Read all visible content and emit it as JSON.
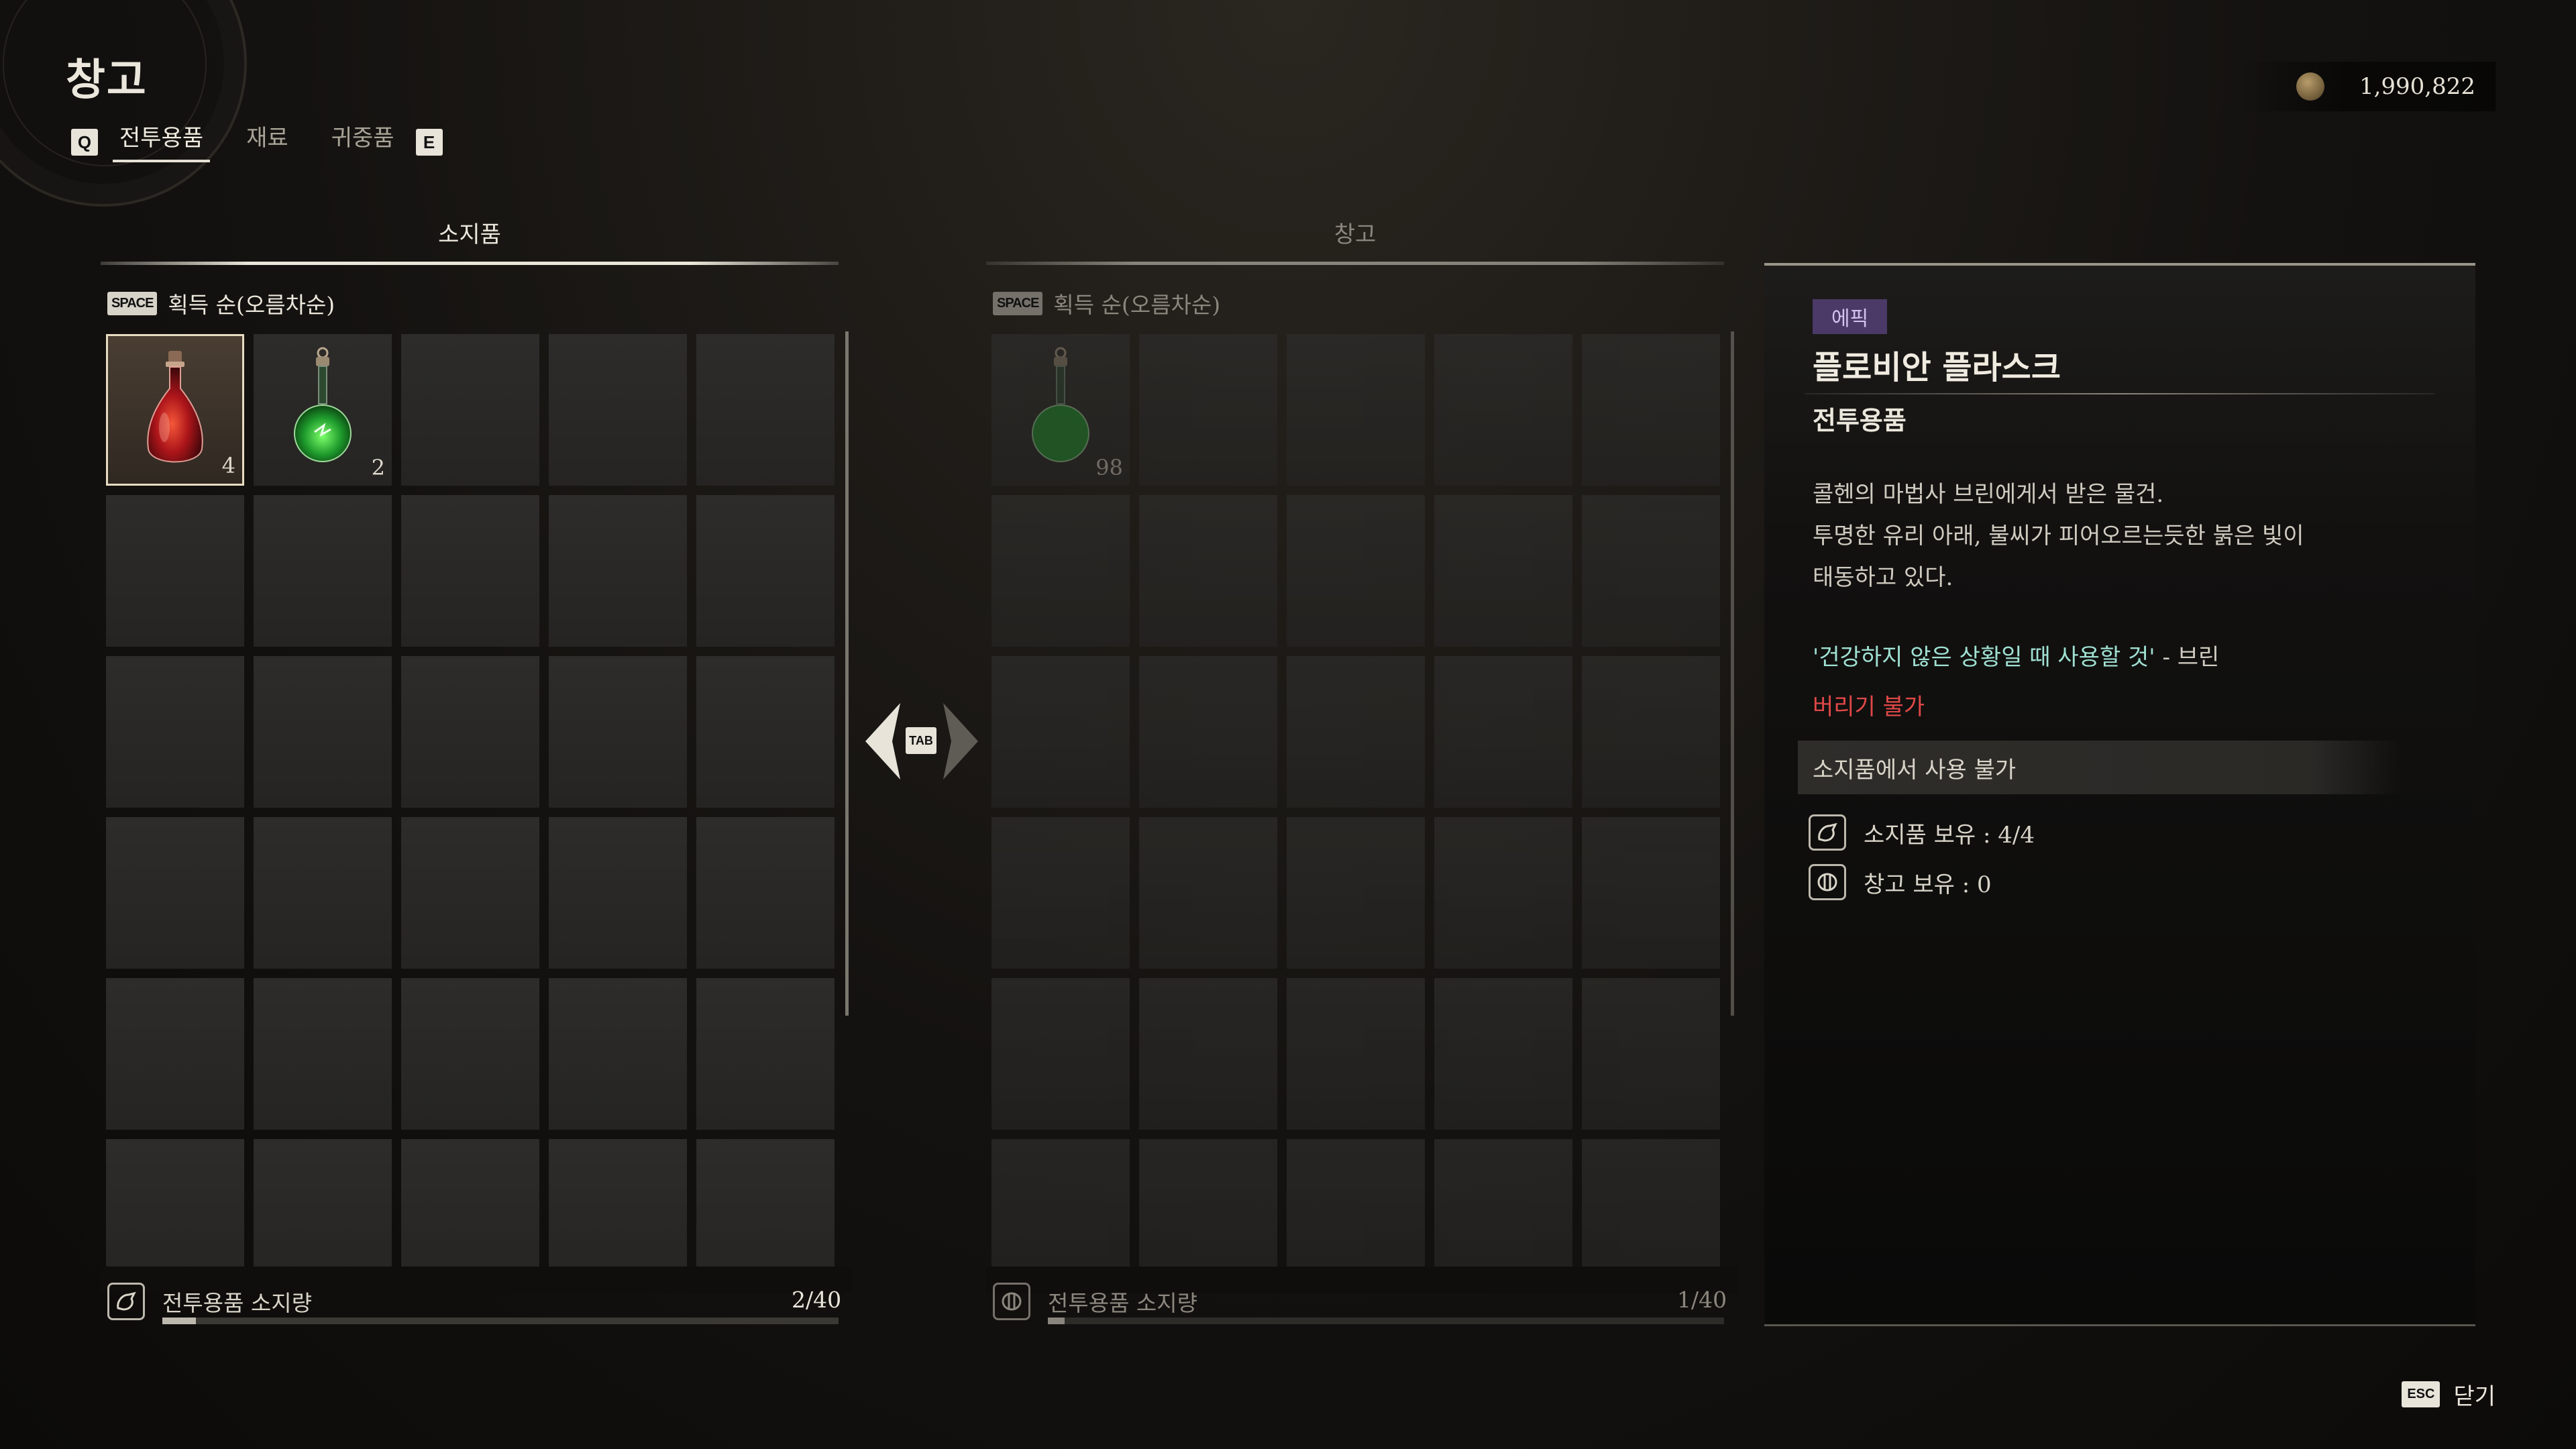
{
  "header": {
    "title": "창고",
    "prev_key": "Q",
    "next_key": "E",
    "tabs": [
      {
        "label": "전투용품",
        "active": true
      },
      {
        "label": "재료",
        "active": false
      },
      {
        "label": "귀중품",
        "active": false
      }
    ]
  },
  "currency": {
    "icon": "coin-icon",
    "value": "1,990,822"
  },
  "inventory": {
    "heading": "소지품",
    "sort_key": "SPACE",
    "sort_label": "획득 순(오름차순)",
    "slots": [
      {
        "item": "red-potion",
        "qty": "4",
        "selected": true
      },
      {
        "item": "green-flask",
        "qty": "2",
        "selected": false
      }
    ],
    "footer_label": "전투용품 소지량",
    "footer_count": "2/40",
    "fill": 0.05
  },
  "swap": {
    "key": "TAB"
  },
  "storage": {
    "heading": "창고",
    "sort_key": "SPACE",
    "sort_label": "획득 순(오름차순)",
    "slots": [
      {
        "item": "green-flask",
        "qty": "98",
        "selected": false
      }
    ],
    "footer_label": "전투용품 소지량",
    "footer_count": "1/40",
    "fill": 0.025
  },
  "detail": {
    "rarity": "에픽",
    "rarity_color": "#4b3a67",
    "name": "플로비안 플라스크",
    "category": "전투용품",
    "description": "콜헨의 마법사 브린에게서 받은 물건.\n투명한 유리 아래, 불씨가 피어오르는듯한 붉은 빛이\n태동하고 있다.",
    "quote": "'건강하지 않은 상황일 때 사용할 것'",
    "quote_author": " - 브린",
    "no_drop": "버리기 불가",
    "no_drop_color": "#e04848",
    "use_restriction": "소지품에서 사용 불가",
    "owned_inventory": "소지품 보유 : 4/4",
    "owned_storage": "창고 보유 : 0"
  },
  "close": {
    "key": "ESC",
    "label": "닫기"
  }
}
